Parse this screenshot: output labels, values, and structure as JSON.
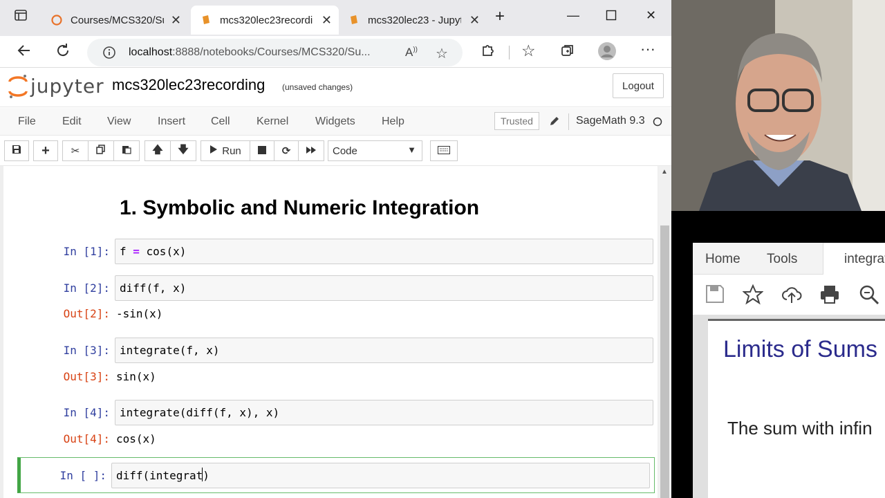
{
  "browser": {
    "tabs": [
      {
        "title": "Courses/MCS320/Su",
        "active": false
      },
      {
        "title": "mcs320lec23recordi",
        "active": true
      },
      {
        "title": "mcs320lec23 - Jupyt",
        "active": false
      }
    ],
    "url_host": "localhost",
    "url_rest": ":8888/notebooks/Courses/MCS320/Su..."
  },
  "jupyter": {
    "logo_text": "jupyter",
    "notebook_title": "mcs320lec23recording",
    "save_status": "(unsaved changes)",
    "logout_label": "Logout",
    "menu": [
      "File",
      "Edit",
      "View",
      "Insert",
      "Cell",
      "Kernel",
      "Widgets",
      "Help"
    ],
    "trusted_label": "Trusted",
    "kernel_name": "SageMath 9.3",
    "toolbar": {
      "run_label": "Run",
      "cell_type": "Code"
    }
  },
  "notebook": {
    "heading": "1. Symbolic and Numeric Integration",
    "cells": [
      {
        "in_prompt": "In [1]:",
        "code_parts": [
          "f ",
          "=",
          " cos(x)"
        ],
        "out_prompt": "",
        "output": ""
      },
      {
        "in_prompt": "In [2]:",
        "code": "diff(f, x)",
        "out_prompt": "Out[2]:",
        "output": "-sin(x)"
      },
      {
        "in_prompt": "In [3]:",
        "code": "integrate(f, x)",
        "out_prompt": "Out[3]:",
        "output": "sin(x)"
      },
      {
        "in_prompt": "In [4]:",
        "code": "integrate(diff(f, x), x)",
        "out_prompt": "Out[4]:",
        "output": "cos(x)"
      },
      {
        "in_prompt": "In [ ]:",
        "code": "diff(integrat)",
        "out_prompt": "",
        "output": ""
      }
    ]
  },
  "pdf": {
    "tabs": [
      "Home",
      "Tools",
      "integrat"
    ],
    "title": "Limits of Sums",
    "body": "The sum with infin"
  },
  "colors": {
    "in_prompt": "#303f9f",
    "out_prompt": "#d84315",
    "selected_cell": "#42a545",
    "pdf_title": "#2b2b8c"
  }
}
